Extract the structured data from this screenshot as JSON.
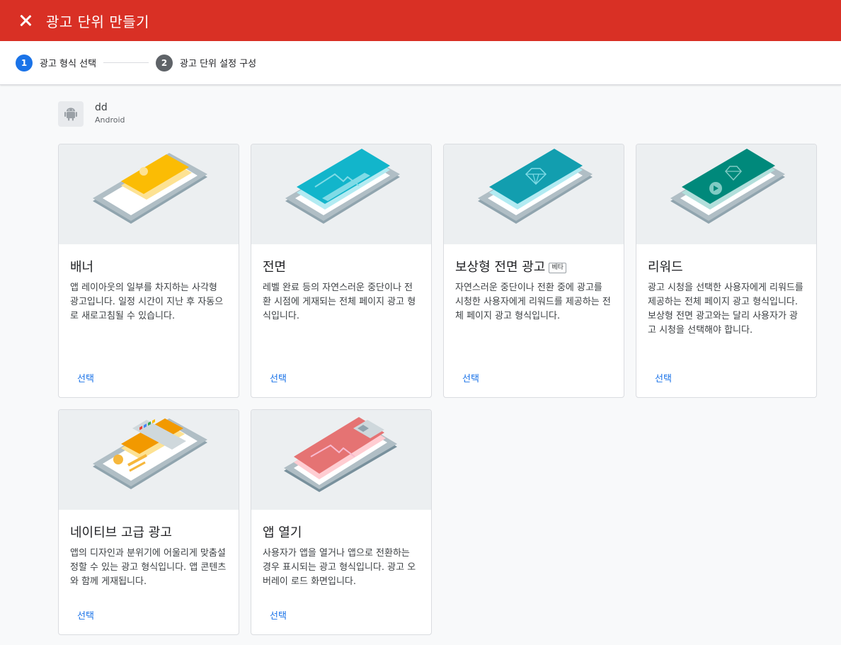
{
  "header": {
    "title": "광고 단위 만들기"
  },
  "stepper": {
    "steps": [
      {
        "number": "1",
        "label": "광고 형식 선택"
      },
      {
        "number": "2",
        "label": "광고 단위 설정 구성"
      }
    ]
  },
  "app": {
    "name": "dd",
    "platform": "Android"
  },
  "cards": [
    {
      "title": "배너",
      "badge": "",
      "description": "앱 레이아웃의 일부를 차지하는 사각형 광고입니다. 일정 시간이 지난 후 자동으로 새로고침될 수 있습니다.",
      "action": "선택",
      "accent": "#fbbc04"
    },
    {
      "title": "전면",
      "badge": "",
      "description": "레벨 완료 등의 자연스러운 중단이나 전환 시점에 게재되는 전체 페이지 광고 형식입니다.",
      "action": "선택",
      "accent": "#12b5cb"
    },
    {
      "title": "보상형 전면 광고",
      "badge": "베타",
      "description": "자연스러운 중단이나 전환 중에 광고를 시청한 사용자에게 리워드를 제공하는 전체 페이지 광고 형식입니다.",
      "action": "선택",
      "accent": "#129eaf"
    },
    {
      "title": "리워드",
      "badge": "",
      "description": "광고 시청을 선택한 사용자에게 리워드를 제공하는 전체 페이지 광고 형식입니다. 보상형 전면 광고와는 달리 사용자가 광고 시청을 선택해야 합니다.",
      "action": "선택",
      "accent": "#00897b"
    },
    {
      "title": "네이티브 고급 광고",
      "badge": "",
      "description": "앱의 디자인과 분위기에 어울리게 맞춤설정할 수 있는 광고 형식입니다. 앱 콘텐츠와 함께 게재됩니다.",
      "action": "선택",
      "accent": "#f29900"
    },
    {
      "title": "앱 열기",
      "badge": "",
      "description": "사용자가 앱을 열거나 앱으로 전환하는 경우 표시되는 광고 형식입니다. 광고 오버레이 로드 화면입니다.",
      "action": "선택",
      "accent": "#e57373"
    }
  ],
  "colors": {
    "header_bg": "#d93025",
    "primary": "#1a73e8"
  }
}
